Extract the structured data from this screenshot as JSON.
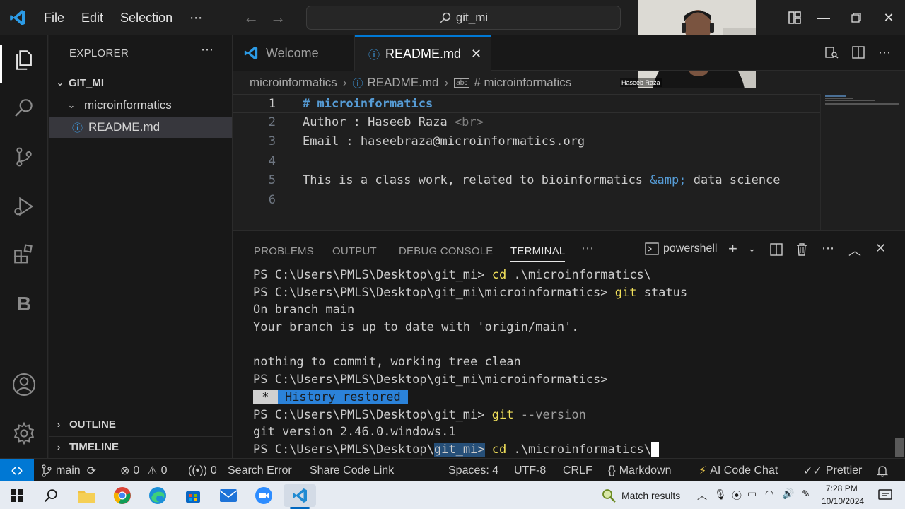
{
  "title_bar": {
    "menus": [
      "File",
      "Edit",
      "Selection",
      "⋯"
    ],
    "search_text": "git_mi"
  },
  "webcam": {
    "name": "Haseeb Raza"
  },
  "explorer": {
    "title": "EXPLORER",
    "root": "GIT_MI",
    "folder": "microinformatics",
    "file": "README.md",
    "outline": "OUTLINE",
    "timeline": "TIMELINE"
  },
  "tabs": [
    {
      "label": "Welcome"
    },
    {
      "label": "README.md"
    }
  ],
  "breadcrumb": [
    "microinformatics",
    "README.md",
    "# microinformatics"
  ],
  "editor": {
    "line_numbers": [
      "1",
      "2",
      "3",
      "4",
      "5",
      "6"
    ],
    "lines": {
      "l1": "# microinformatics",
      "l2_text": "Author : Haseeb Raza ",
      "l2_tag": "<br>",
      "l3": "Email : haseebraza@microinformatics.org",
      "l4": "",
      "l5_text": "This is a class work, related to bioinformatics ",
      "l5_entity": "&amp;",
      "l5_rest": " data science",
      "l6": ""
    }
  },
  "panel": {
    "tabs": [
      "PROBLEMS",
      "OUTPUT",
      "DEBUG CONSOLE",
      "TERMINAL"
    ],
    "active_tab": "TERMINAL",
    "shell": "powershell",
    "terminal": {
      "t1_prompt": "PS C:\\Users\\PMLS\\Desktop\\git_mi> ",
      "t1_cmd": "cd",
      "t1_args": " .\\microinformatics\\",
      "t2_prompt": "PS C:\\Users\\PMLS\\Desktop\\git_mi\\microinformatics> ",
      "t2_cmd": "git",
      "t2_args": " status",
      "t3": "On branch main",
      "t4": "Your branch is up to date with 'origin/main'.",
      "t5": "",
      "t6": "nothing to commit, working tree clean",
      "t7": "PS C:\\Users\\PMLS\\Desktop\\git_mi\\microinformatics>",
      "t8_star": " * ",
      "t8_msg": " History restored ",
      "t9_prompt": "PS C:\\Users\\PMLS\\Desktop\\git_mi> ",
      "t9_cmd": "git",
      "t9_flag": " --version",
      "t10": "git version 2.46.0.windows.1",
      "t11_prompt_a": "PS C:\\Users\\PMLS\\Desktop\\",
      "t11_sel": "git_mi>",
      "t11_cmd": " cd",
      "t11_args": " .\\microinformatics\\"
    }
  },
  "status_bar": {
    "branch": "main",
    "errors": "0",
    "warnings": "0",
    "ports": "0",
    "search_error": "Search Error",
    "share": "Share Code Link",
    "spaces": "Spaces: 4",
    "encoding": "UTF-8",
    "eol": "CRLF",
    "language": "Markdown",
    "ai": "AI Code Chat",
    "prettier": "Prettier"
  },
  "taskbar": {
    "search_widget": "Match results",
    "time": "7:28 PM",
    "date": "10/10/2024"
  },
  "colors": {
    "accent": "#0078d4",
    "heading": "#569cd6",
    "terminal_command": "#f1e05a",
    "history_badge": "#2b82d9"
  }
}
